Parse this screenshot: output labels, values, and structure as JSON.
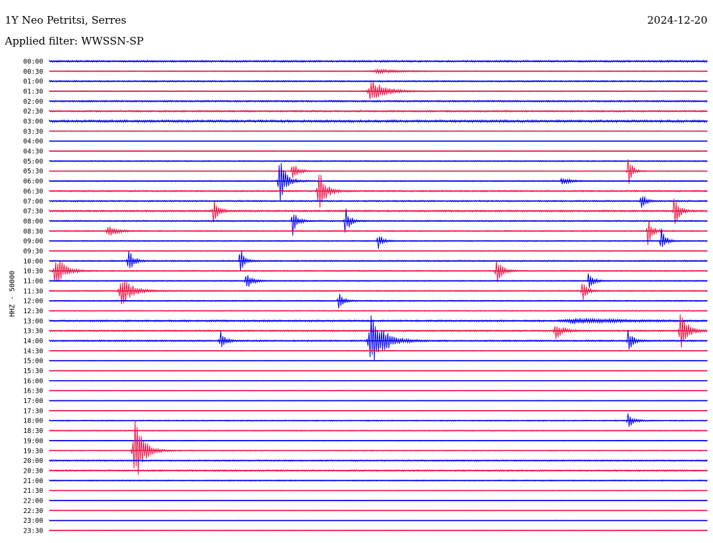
{
  "header": {
    "station": "1Y Neo Petritsi, Serres",
    "date": "2024-12-20",
    "filter_label": "Applied filter:",
    "filter_name": "WWSSN-SP"
  },
  "channel": "HHZ - 50000",
  "colors": {
    "even_row": "#0000ee",
    "odd_row": "#ee1144"
  },
  "chart_data": {
    "type": "line",
    "title": "",
    "ylabel": "HHZ - 50000",
    "xlabel": "",
    "rows": [
      "00:00",
      "00:30",
      "01:00",
      "01:30",
      "02:00",
      "02:30",
      "03:00",
      "03:30",
      "04:00",
      "04:30",
      "05:00",
      "05:30",
      "06:00",
      "06:30",
      "07:00",
      "07:30",
      "08:00",
      "08:30",
      "09:00",
      "09:30",
      "10:00",
      "10:30",
      "11:00",
      "11:30",
      "12:00",
      "12:30",
      "13:00",
      "13:30",
      "14:00",
      "14:30",
      "15:00",
      "15:30",
      "16:00",
      "16:30",
      "17:00",
      "17:30",
      "18:00",
      "18:30",
      "19:00",
      "19:30",
      "20:00",
      "20:30",
      "21:00",
      "21:30",
      "22:00",
      "22:30",
      "23:00",
      "23:30"
    ],
    "noise": [
      1.0,
      0.5,
      0.8,
      0.5,
      0.9,
      0.9,
      1.3,
      0.4,
      0.2,
      0.4,
      0.6,
      0.4,
      0.6,
      0.8,
      0.8,
      0.9,
      0.7,
      0.6,
      0.6,
      0.5,
      0.7,
      0.6,
      0.6,
      0.6,
      0.6,
      0.5,
      0.9,
      0.8,
      0.8,
      0.4,
      0.3,
      0.3,
      0.3,
      0.3,
      0.3,
      0.3,
      0.6,
      0.5,
      0.4,
      0.5,
      0.7,
      0.8,
      0.6,
      0.4,
      0.3,
      0.3,
      0.3,
      0.3
    ],
    "events": [
      {
        "row": 1,
        "t": 0.5,
        "amp": 3,
        "width": 0.03
      },
      {
        "row": 3,
        "t": 0.49,
        "amp": 16,
        "width": 0.02
      },
      {
        "row": 11,
        "t": 0.37,
        "amp": 14,
        "width": 0.008
      },
      {
        "row": 11,
        "t": 0.88,
        "amp": 22,
        "width": 0.006
      },
      {
        "row": 12,
        "t": 0.35,
        "amp": 34,
        "width": 0.009
      },
      {
        "row": 12,
        "t": 0.78,
        "amp": 6,
        "width": 0.01
      },
      {
        "row": 13,
        "t": 0.41,
        "amp": 30,
        "width": 0.01
      },
      {
        "row": 14,
        "t": 0.9,
        "amp": 12,
        "width": 0.006
      },
      {
        "row": 15,
        "t": 0.25,
        "amp": 24,
        "width": 0.006
      },
      {
        "row": 15,
        "t": 0.95,
        "amp": 28,
        "width": 0.006
      },
      {
        "row": 16,
        "t": 0.37,
        "amp": 22,
        "width": 0.006
      },
      {
        "row": 16,
        "t": 0.45,
        "amp": 22,
        "width": 0.006
      },
      {
        "row": 17,
        "t": 0.09,
        "amp": 8,
        "width": 0.012
      },
      {
        "row": 17,
        "t": 0.91,
        "amp": 24,
        "width": 0.006
      },
      {
        "row": 18,
        "t": 0.5,
        "amp": 12,
        "width": 0.006
      },
      {
        "row": 18,
        "t": 0.93,
        "amp": 20,
        "width": 0.006
      },
      {
        "row": 20,
        "t": 0.12,
        "amp": 20,
        "width": 0.007
      },
      {
        "row": 20,
        "t": 0.29,
        "amp": 20,
        "width": 0.006
      },
      {
        "row": 21,
        "t": 0.01,
        "amp": 26,
        "width": 0.012
      },
      {
        "row": 21,
        "t": 0.68,
        "amp": 20,
        "width": 0.008
      },
      {
        "row": 22,
        "t": 0.3,
        "amp": 12,
        "width": 0.008
      },
      {
        "row": 22,
        "t": 0.82,
        "amp": 16,
        "width": 0.006
      },
      {
        "row": 23,
        "t": 0.11,
        "amp": 22,
        "width": 0.015
      },
      {
        "row": 23,
        "t": 0.81,
        "amp": 20,
        "width": 0.006
      },
      {
        "row": 24,
        "t": 0.44,
        "amp": 18,
        "width": 0.006
      },
      {
        "row": 26,
        "t": 0.8,
        "amp": 4,
        "width": 0.06
      },
      {
        "row": 27,
        "t": 0.77,
        "amp": 12,
        "width": 0.01
      },
      {
        "row": 27,
        "t": 0.96,
        "amp": 30,
        "width": 0.01
      },
      {
        "row": 28,
        "t": 0.26,
        "amp": 14,
        "width": 0.007
      },
      {
        "row": 28,
        "t": 0.49,
        "amp": 42,
        "width": 0.018
      },
      {
        "row": 28,
        "t": 0.88,
        "amp": 18,
        "width": 0.006
      },
      {
        "row": 36,
        "t": 0.88,
        "amp": 12,
        "width": 0.007
      },
      {
        "row": 39,
        "t": 0.13,
        "amp": 52,
        "width": 0.012
      }
    ]
  }
}
